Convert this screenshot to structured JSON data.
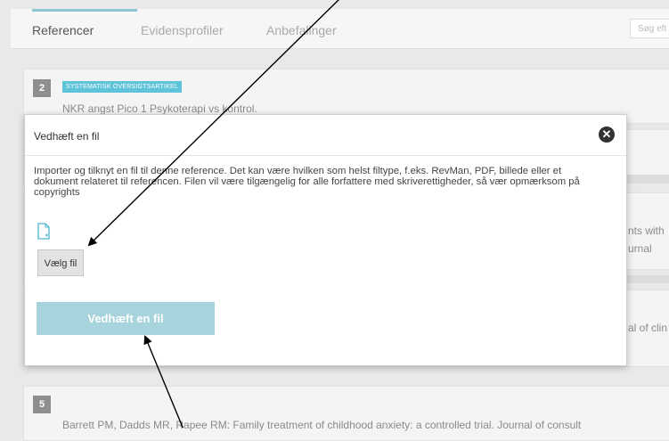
{
  "tabs": [
    {
      "label": "Referencer"
    },
    {
      "label": "Evidensprofiler"
    },
    {
      "label": "Anbefalinger"
    }
  ],
  "search": {
    "placeholder": "Søg eft"
  },
  "references": [
    {
      "number": "2",
      "type_badge": "SYSTEMATISK OVERSIGTSARTIKEL",
      "title": "NKR angst Pico 1 Psykoterapi vs kontrol."
    },
    {
      "number": "5",
      "title": "Barrett PM, Dadds MR, Rapee RM: Family treatment of childhood anxiety: a controlled trial. Journal of consult"
    }
  ],
  "partial_texts": [
    "nts with",
    "urnal",
    "al of clin"
  ],
  "modal": {
    "title": "Vedhæft en fil",
    "description": "Importer og tilknyt en fil til denne reference. Det kan være hvilken som helst filtype, f.eks. RevMan, PDF, billede eller et dokument relateret til referencen. Filen vil være tilgængelig for alle forfattere med skriverettigheder, så vær opmærksom på copyrights",
    "choose_file_label": "Vælg fil",
    "attach_button_label": "Vedhæft en fil"
  },
  "colors": {
    "accent": "#8ec6d3",
    "badge": "#5fc3d9",
    "attach_button": "#a6d3dc",
    "file_icon": "#4db6cf"
  },
  "icons": {
    "close": "close-icon",
    "file": "file-add-icon"
  }
}
